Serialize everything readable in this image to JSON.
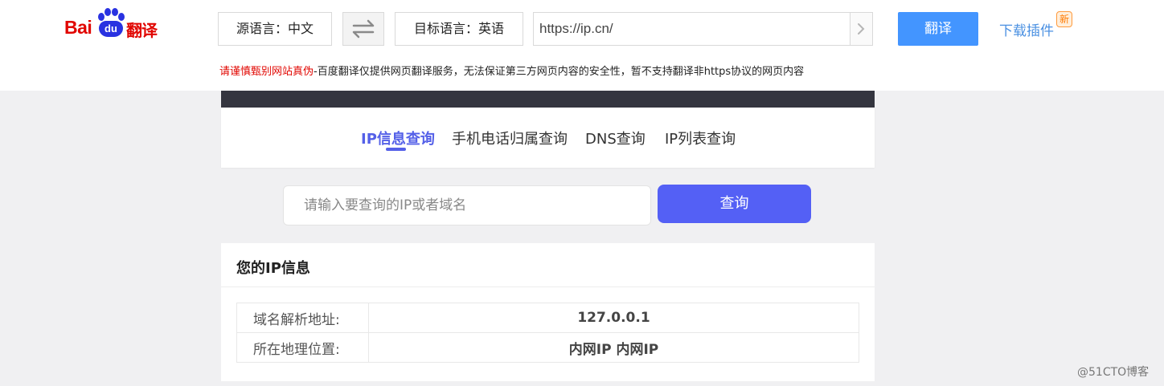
{
  "translate_bar": {
    "logo": {
      "bai": "Bai",
      "du": "du",
      "fanyi": "翻译"
    },
    "source_lang": "源语言：中文",
    "target_lang": "目标语言：英语",
    "url_value": "https://ip.cn/",
    "translate_label": "翻译",
    "plugin_label": "下载插件",
    "new_badge": "新",
    "notice_warning": "请谨慎甄别网站真伪",
    "notice_text": "-百度翻译仅提供网页翻译服务，无法保证第三方网页内容的安全性，暂不支持翻译非https协议的网页内容",
    "colors": {
      "brand_red": "#e10601",
      "brand_blue": "#2932e1",
      "button_blue": "#4395ff",
      "link_blue": "#4a90e2"
    }
  },
  "site": {
    "tabs": [
      {
        "label": "IP信息查询",
        "active": true
      },
      {
        "label": "手机电话归属查询",
        "active": false
      },
      {
        "label": "DNS查询",
        "active": false
      },
      {
        "label": "IP列表查询",
        "active": false
      }
    ],
    "search": {
      "placeholder": "请输入要查询的IP或者域名",
      "button_label": "查询"
    },
    "info": {
      "title": "您的IP信息",
      "rows": [
        {
          "key": "域名解析地址:",
          "value": "127.0.0.1"
        },
        {
          "key": "所在地理位置:",
          "value": "内网IP 内网IP"
        }
      ]
    },
    "colors": {
      "accent": "#5460f5",
      "header_dark": "#34353f"
    }
  },
  "watermark": "@51CTO博客"
}
